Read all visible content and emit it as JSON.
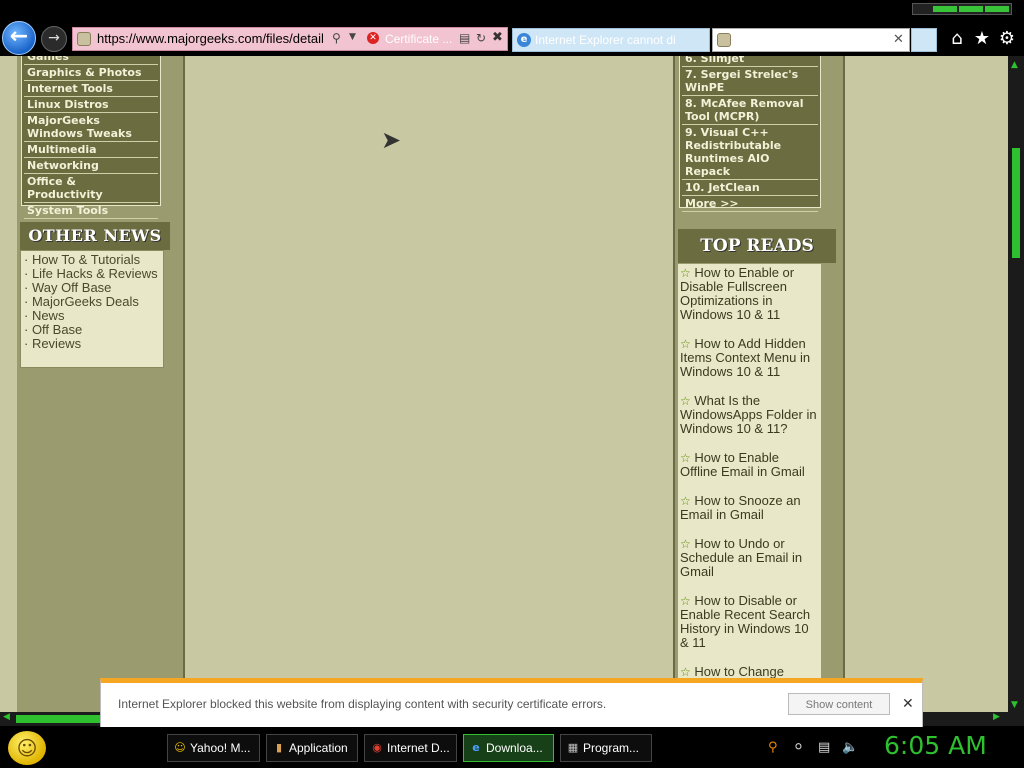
{
  "browser": {
    "address_url": "https://www.majorgeeks.com/files/detail",
    "cert_error_label": "Certificate ...",
    "tabs": [
      {
        "label": "Internet Explorer cannot di"
      },
      {
        "label": ""
      }
    ]
  },
  "left_sidebar": {
    "categories": [
      "Games",
      "Graphics & Photos",
      "Internet Tools",
      "Linux Distros",
      "MajorGeeks Windows Tweaks",
      "Multimedia",
      "Networking",
      "Office & Productivity",
      "System Tools"
    ],
    "other_news_title": "OTHER NEWS",
    "other_news": [
      "· How To & Tutorials",
      "· Life Hacks & Reviews",
      "· Way Off Base",
      "· MajorGeeks Deals",
      "· News",
      "· Off Base",
      "· Reviews"
    ]
  },
  "right_sidebar": {
    "top_downloads": [
      "6. Slimjet",
      "7. Sergei Strelec's WinPE",
      "8. McAfee Removal Tool (MCPR)",
      "9. Visual C++ Redistributable Runtimes AIO Repack",
      "10. JetClean",
      "More >>"
    ],
    "top_reads_title": "TOP READS",
    "top_reads": [
      "How to Enable or Disable Fullscreen Optimizations in Windows 10 & 11",
      "How to Add Hidden Items Context Menu in Windows 10 & 11",
      "What Is the WindowsApps Folder in Windows 10 & 11?",
      "How to Enable Offline Email in Gmail",
      "How to Snooze an Email in Gmail",
      "How to Undo or Schedule an Email in Gmail",
      "How to Disable or Enable Recent Search History in Windows 10 & 11",
      "How to Change"
    ]
  },
  "notification": {
    "message": "Internet Explorer blocked this website from displaying content with security certificate errors.",
    "show_content_label": "Show content"
  },
  "taskbar": {
    "tasks": [
      {
        "label": "Yahoo! M..."
      },
      {
        "label": "Application"
      },
      {
        "label": "Internet D..."
      },
      {
        "label": "Downloa..."
      },
      {
        "label": "Program..."
      }
    ],
    "clock": "6:05 AM"
  },
  "colors": {
    "accent_green": "#2ec02e",
    "page_bg": "#c8c8a2",
    "sidebar_dark": "#6b6c3f",
    "notification_bar": "#f5a623"
  },
  "icons": {
    "back": "arrow-left-icon",
    "forward": "arrow-right-icon",
    "home": "home-icon",
    "favorites": "star-icon",
    "tools": "gear-icon"
  }
}
